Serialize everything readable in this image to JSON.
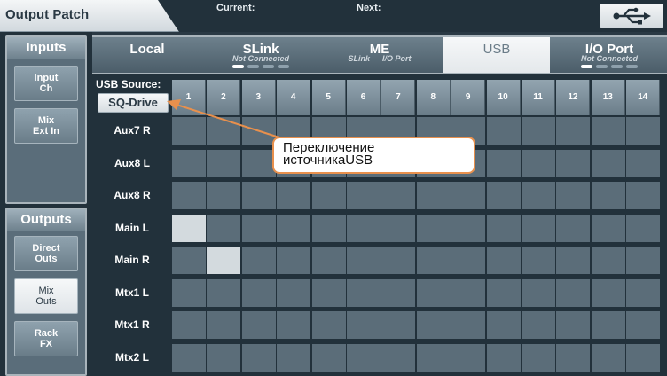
{
  "header": {
    "title": "Output Patch",
    "current_label": "Current:",
    "next_label": "Next:",
    "usb_icon": "usb-icon"
  },
  "left_panel": {
    "inputs": {
      "title": "Inputs",
      "items": [
        "Input\nCh",
        "Mix\nExt In"
      ]
    },
    "outputs": {
      "title": "Outputs",
      "items": [
        "Direct\nOuts",
        "Mix\nOuts",
        "Rack\nFX"
      ],
      "active": "Mix\nOuts"
    }
  },
  "tabs": {
    "local": {
      "label": "Local"
    },
    "slink": {
      "label": "SLink",
      "sub": "Not Connected"
    },
    "me": {
      "label": "ME",
      "sub1": "SLink",
      "sub2": "I/O Port"
    },
    "usb": {
      "label": "USB"
    },
    "ioport": {
      "label": "I/O Port",
      "sub": "Not Connected"
    },
    "active": "USB"
  },
  "patch": {
    "source_label": "USB Source:",
    "source_value": "SQ-Drive",
    "columns": [
      "1",
      "2",
      "3",
      "4",
      "5",
      "6",
      "7",
      "8",
      "9",
      "10",
      "11",
      "12",
      "13",
      "14"
    ],
    "rows": [
      "Aux7 R",
      "Aux8 L",
      "Aux8 R",
      "Main L",
      "Main R",
      "Mtx1 L",
      "Mtx1 R",
      "Mtx2 L"
    ],
    "active_cells": [
      [
        3,
        0
      ],
      [
        4,
        1
      ]
    ]
  },
  "annotation": {
    "line1": "Переключение",
    "line2": "источникаUSB",
    "color": "#e8904d"
  }
}
